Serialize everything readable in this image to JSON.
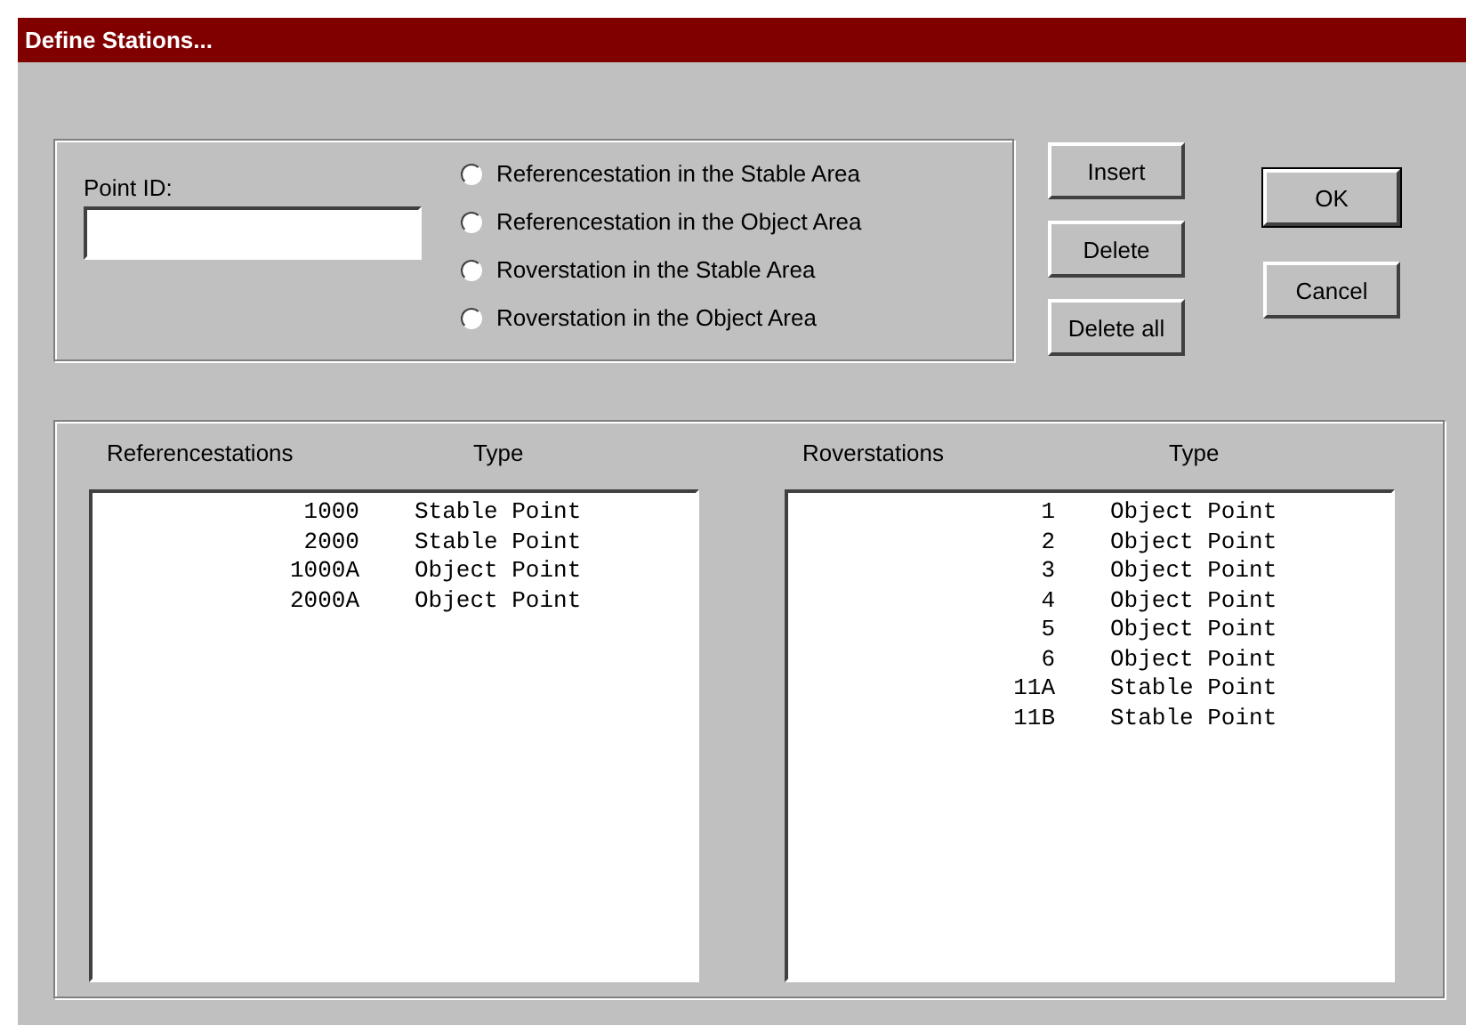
{
  "window": {
    "title": "Define Stations..."
  },
  "point_id": {
    "label": "Point ID:"
  },
  "station_types": [
    {
      "label": "Referencestation in the Stable Area",
      "selected": false
    },
    {
      "label": "Referencestation in the Object Area",
      "selected": false
    },
    {
      "label": "Roverstation in the Stable Area",
      "selected": false
    },
    {
      "label": "Roverstation in the Object Area",
      "selected": false
    }
  ],
  "edit_buttons": [
    "Insert",
    "Delete",
    "Delete all"
  ],
  "dialog_buttons": [
    {
      "label": "OK",
      "default": true
    },
    {
      "label": "Cancel",
      "default": false
    }
  ],
  "lists": [
    {
      "columns": [
        "Referencestations",
        "Type"
      ],
      "rows": [
        {
          "id": "1000",
          "type": "Stable Point"
        },
        {
          "id": "2000",
          "type": "Stable Point"
        },
        {
          "id": "1000A",
          "type": "Object Point"
        },
        {
          "id": "2000A",
          "type": "Object Point"
        }
      ]
    },
    {
      "columns": [
        "Roverstations",
        "Type"
      ],
      "rows": [
        {
          "id": "1",
          "type": "Object Point"
        },
        {
          "id": "2",
          "type": "Object Point"
        },
        {
          "id": "3",
          "type": "Object Point"
        },
        {
          "id": "4",
          "type": "Object Point"
        },
        {
          "id": "5",
          "type": "Object Point"
        },
        {
          "id": "6",
          "type": "Object Point"
        },
        {
          "id": "11A",
          "type": "Stable Point"
        },
        {
          "id": "11B",
          "type": "Stable Point"
        }
      ]
    }
  ]
}
